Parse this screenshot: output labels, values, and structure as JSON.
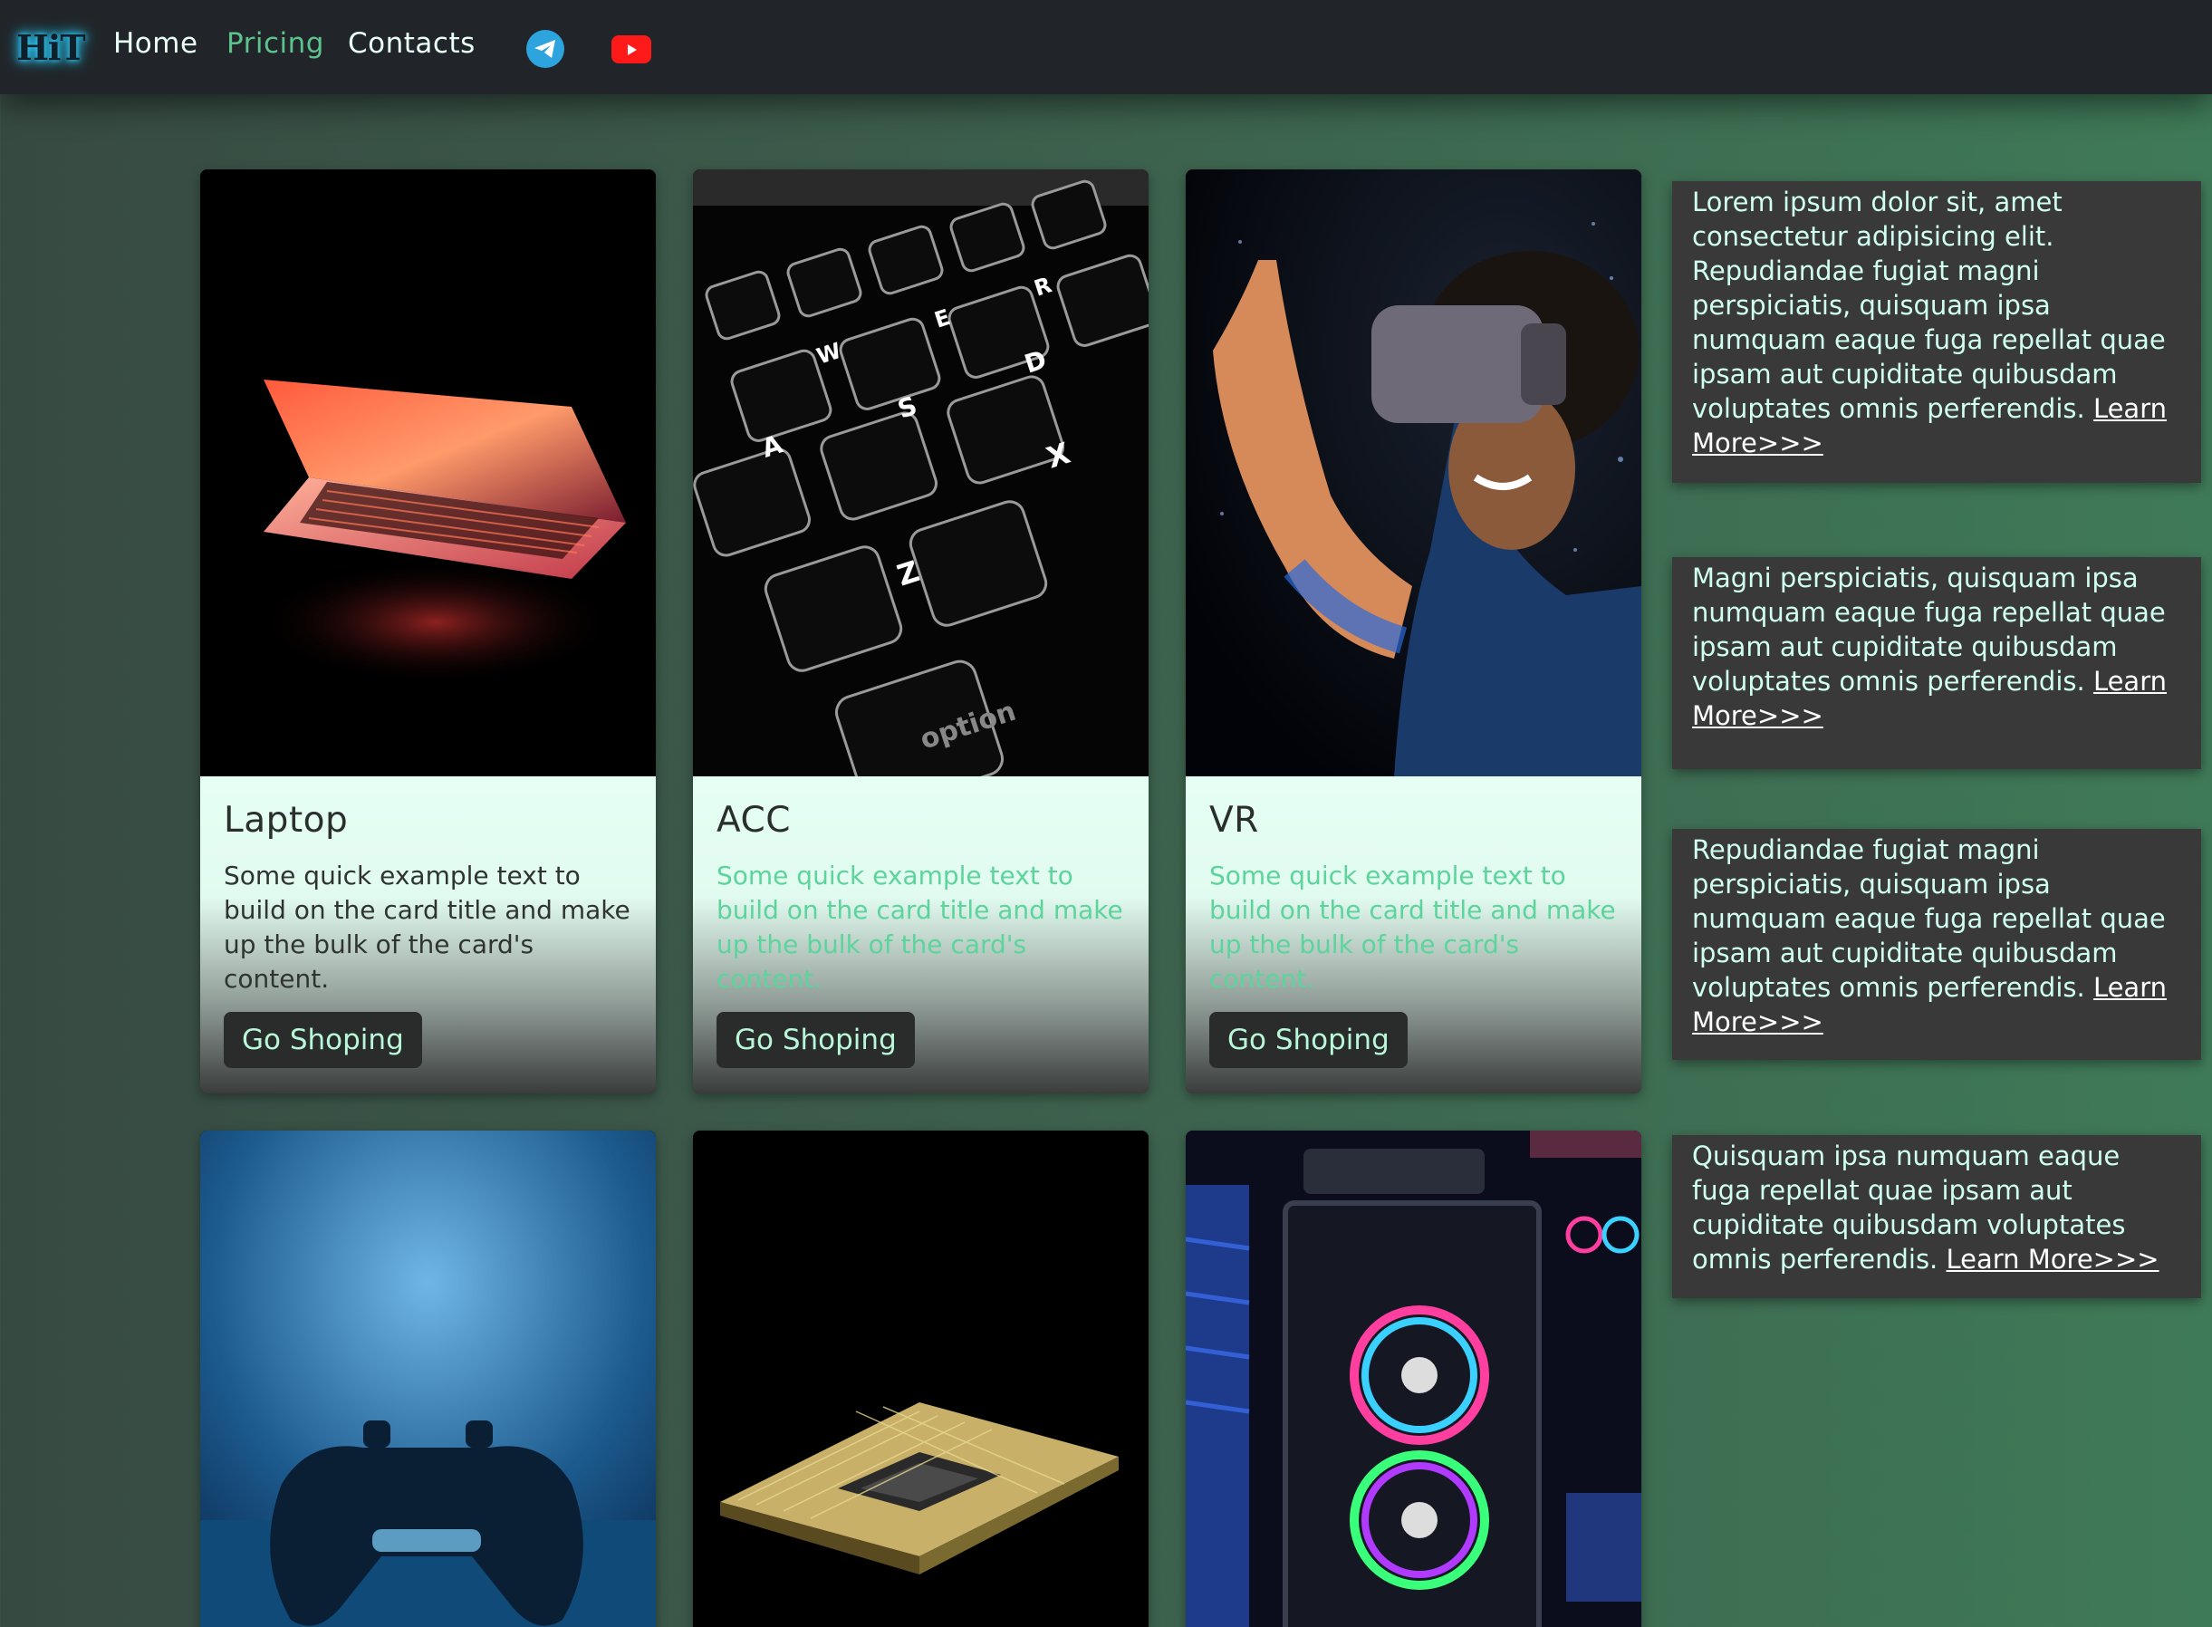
{
  "nav": {
    "logo": "HiT",
    "links": [
      "Home",
      "Pricing",
      "Contacts"
    ]
  },
  "cards": [
    {
      "title": "Laptop",
      "text": "Some quick example text to build on the card title and make up the bulk of the card's content.",
      "button": "Go Shoping"
    },
    {
      "title": "ACC",
      "text": "Some quick example text to build on the card title and make up the bulk of the card's content.",
      "button": "Go Shoping"
    },
    {
      "title": "VR",
      "text": "Some quick example text to build on the card title and make up the bulk of the card's content.",
      "button": "Go Shoping"
    }
  ],
  "side": [
    {
      "text": "Lorem ipsum dolor sit, amet consectetur adipisicing elit. Repudiandae fugiat magni perspiciatis, quisquam ipsa numquam eaque fuga repellat quae ipsam aut cupiditate quibusdam voluptates omnis perferendis.",
      "link": "Learn More>>>"
    },
    {
      "text": "Magni perspiciatis, quisquam ipsa numquam eaque fuga repellat quae ipsam aut cupiditate quibusdam voluptates omnis perferendis.",
      "link": "Learn More>>>"
    },
    {
      "text": "Repudiandae fugiat magni perspiciatis, quisquam ipsa numquam eaque fuga repellat quae ipsam aut cupiditate quibusdam voluptates omnis perferendis.",
      "link": "Learn More>>>"
    },
    {
      "text": "Quisquam ipsa numquam eaque fuga repellat quae ipsam aut cupiditate quibusdam voluptates omnis perferendis.",
      "link": "Learn More>>>"
    }
  ],
  "colors": {
    "navbar": "#212529",
    "accent": "#5cc38c",
    "card_body": "#e6fff4",
    "side_box": "#393939"
  }
}
